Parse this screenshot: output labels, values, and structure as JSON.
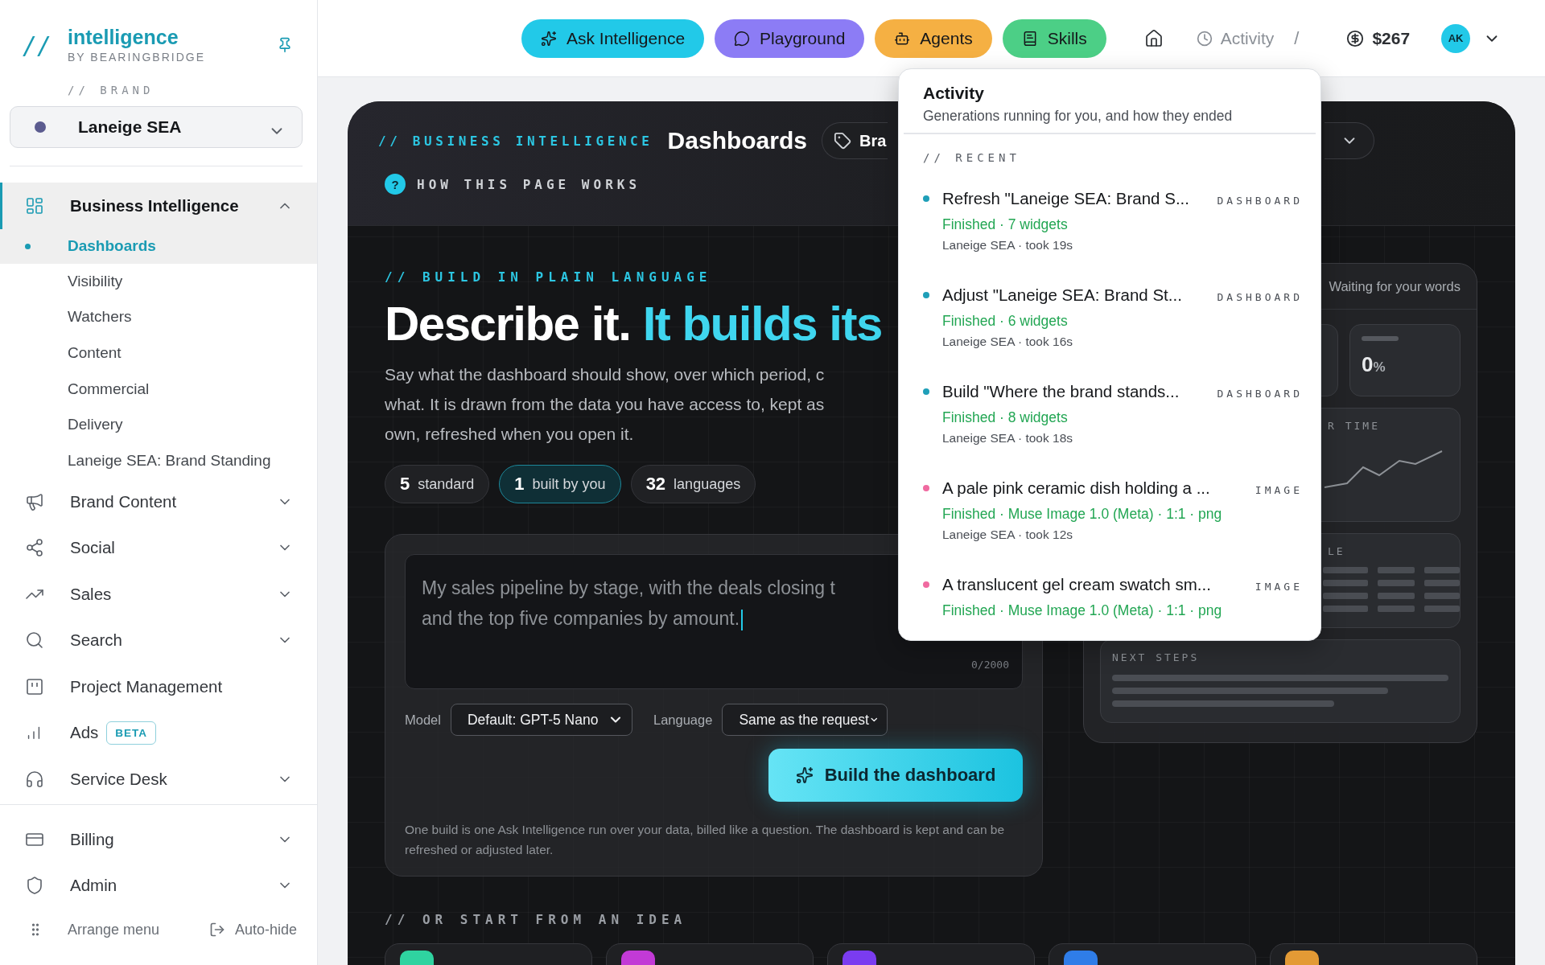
{
  "sidebar": {
    "logo": {
      "mark": "//",
      "name": "intelligence",
      "byline": "BY BEARINGBRIDGE"
    },
    "section_label": "// BRAND",
    "brand_select": {
      "value": "Laneige SEA",
      "color": "#5b5b8f"
    },
    "nav": [
      {
        "label": "Business Intelligence",
        "selected": true,
        "expanded": true,
        "children": [
          {
            "label": "Dashboards",
            "selected": true
          },
          {
            "label": "Visibility",
            "selected": false
          },
          {
            "label": "Watchers",
            "selected": false
          },
          {
            "label": "Content",
            "selected": false
          },
          {
            "label": "Commercial",
            "selected": false
          },
          {
            "label": "Delivery",
            "selected": false
          },
          {
            "label": "Laneige SEA: Brand Standing",
            "selected": false
          }
        ]
      },
      {
        "label": "Brand Content",
        "selected": false,
        "expanded": false
      },
      {
        "label": "Social",
        "selected": false,
        "expanded": false
      },
      {
        "label": "Sales",
        "selected": false,
        "expanded": false
      },
      {
        "label": "Search",
        "selected": false,
        "expanded": false
      },
      {
        "label": "Project Management",
        "selected": false
      },
      {
        "label": "Ads",
        "selected": false,
        "badge": "BETA"
      },
      {
        "label": "Service Desk",
        "selected": false,
        "expanded": false
      }
    ],
    "bottom_nav": [
      {
        "label": "Billing",
        "selected": false,
        "expanded": false
      },
      {
        "label": "Admin",
        "selected": false,
        "expanded": false
      }
    ],
    "footer": {
      "arrange": "Arrange menu",
      "autohide": "Auto-hide"
    }
  },
  "topbar": {
    "buttons": [
      {
        "label": "Ask Intelligence",
        "color": "#22c9e8"
      },
      {
        "label": "Playground",
        "color": "#8c7cf5"
      },
      {
        "label": "Agents",
        "color": "#f5b043"
      },
      {
        "label": "Skills",
        "color": "#4ccf86"
      }
    ],
    "activity": "Activity",
    "separator": "/",
    "credits": "$267",
    "avatar": "AK"
  },
  "page": {
    "header": {
      "eyebrow": "// BUSINESS INTELLIGENCE",
      "title": "Dashboards",
      "tag": "Bra",
      "help_mark": "?",
      "help": "HOW THIS PAGE WORKS"
    },
    "hero": {
      "eyebrow": "// BUILD IN PLAIN LANGUAGE",
      "headline": "Describe it.",
      "headline_accent": "It builds its",
      "paragraph_lines": [
        "Say what the dashboard should show, over which period, c",
        "what. It is drawn from the data you have access to, kept as",
        "own, refreshed when you open it."
      ],
      "stats": [
        {
          "value": "5",
          "label": "standard",
          "selected": false
        },
        {
          "value": "1",
          "label": "built by you",
          "selected": true
        },
        {
          "value": "32",
          "label": "languages",
          "selected": false
        }
      ]
    },
    "prompt": {
      "value_lines": [
        "My sales pipeline by stage, with the deals closing t",
        "and the top five companies by amount."
      ],
      "counter": "0/2000",
      "model": {
        "label": "Model",
        "value": "Default: GPT-5 Nano"
      },
      "language": {
        "label": "Language",
        "value": "Same as the request"
      },
      "build_button": "Build the dashboard",
      "footnote": "One build is one Ask Intelligence run over your data, billed like a question. The dashboard is kept and can be refreshed or adjusted later."
    },
    "ideas": {
      "eyebrow": "// OR START FROM AN IDEA",
      "cards": [
        {
          "color": "#2fd3a0"
        },
        {
          "color": "#c23ad6"
        },
        {
          "color": "#7a3cf0"
        },
        {
          "color": "#2f7de8"
        },
        {
          "color": "#e39a35"
        }
      ]
    },
    "preview": {
      "status": "Waiting for your words",
      "stat_value": "0",
      "stat_unit": "%",
      "chart_label": "R TIME",
      "table_label": "LE",
      "next_steps": "NEXT STEPS"
    }
  },
  "activity_popover": {
    "title": "Activity",
    "subtitle": "Generations running for you, and how they ended",
    "section": "// RECENT",
    "items": [
      {
        "title": "Refresh \"Laneige SEA: Brand S...",
        "type": "DASHBOARD",
        "status": "Finished · 7 widgets",
        "meta": "Laneige SEA · took 19s",
        "color": "#1f9fb8"
      },
      {
        "title": "Adjust \"Laneige SEA: Brand St...",
        "type": "DASHBOARD",
        "status": "Finished · 6 widgets",
        "meta": "Laneige SEA · took 16s",
        "color": "#1f9fb8"
      },
      {
        "title": "Build \"Where the brand stands...",
        "type": "DASHBOARD",
        "status": "Finished · 8 widgets",
        "meta": "Laneige SEA · took 18s",
        "color": "#1f9fb8"
      },
      {
        "title": "A pale pink ceramic dish holding a ...",
        "type": "IMAGE",
        "status": "Finished · Muse Image 1.0 (Meta) · 1:1 · png",
        "meta": "Laneige SEA · took 12s",
        "color": "#f06aa0"
      },
      {
        "title": "A translucent gel cream swatch sm...",
        "type": "IMAGE",
        "status": "Finished · Muse Image 1.0 (Meta) · 1:1 · png",
        "color": "#f06aa0"
      }
    ]
  }
}
